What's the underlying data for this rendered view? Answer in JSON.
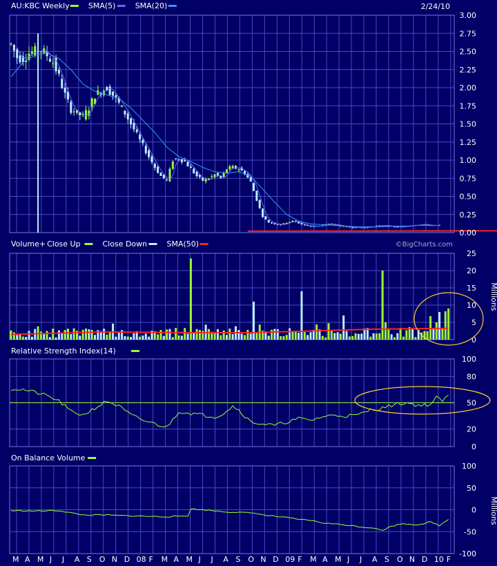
{
  "header": {
    "date": "2/24/10",
    "watermark": "©BigCharts.com"
  },
  "colors": {
    "bg": "#000066",
    "grid": "#4a4ac8",
    "up": "#99ff33",
    "down": "#bbeeff",
    "sma5": "#6666ff",
    "sma20": "#3399ff",
    "sma50": "#ff2222",
    "rsi": "#99ff33",
    "obv": "#99ff33",
    "annotation_circle": "#ffcc33",
    "annotation_line": "#ff2222"
  },
  "x_labels": [
    "M",
    "A",
    "M",
    "J",
    "J",
    "A",
    "S",
    "O",
    "N",
    "D",
    "08",
    "F",
    "M",
    "A",
    "M",
    "J",
    "J",
    "A",
    "S",
    "O",
    "N",
    "D",
    "09",
    "F",
    "M",
    "A",
    "M",
    "J",
    "J",
    "A",
    "S",
    "O",
    "N",
    "D",
    "10",
    "F"
  ],
  "chart_data": [
    {
      "type": "candlestick",
      "legend": [
        {
          "label": "AU:KBC Weekly",
          "color": "#99ff33"
        },
        {
          "label": "SMA(5)",
          "color": "#6666ff"
        },
        {
          "label": "SMA(20)",
          "color": "#3399ff"
        }
      ],
      "y_ticks": [
        "3.00",
        "2.75",
        "2.50",
        "2.25",
        "2.00",
        "1.75",
        "1.50",
        "1.25",
        "1.00",
        "0.75",
        "0.50",
        "0.25",
        "0.00"
      ],
      "ylim": [
        0,
        3
      ],
      "price_path": [
        [
          0,
          2.6
        ],
        [
          2,
          2.42
        ],
        [
          4,
          2.4
        ],
        [
          6,
          2.48
        ],
        [
          8,
          2.5
        ],
        [
          10,
          2.52
        ],
        [
          12,
          2.45
        ],
        [
          14,
          2.35
        ],
        [
          16,
          2.15
        ],
        [
          18,
          1.9
        ],
        [
          20,
          1.7
        ],
        [
          22,
          1.65
        ],
        [
          24,
          1.6
        ],
        [
          26,
          1.72
        ],
        [
          28,
          1.9
        ],
        [
          30,
          1.95
        ],
        [
          32,
          2.0
        ],
        [
          34,
          1.9
        ],
        [
          36,
          1.78
        ],
        [
          38,
          1.65
        ],
        [
          40,
          1.5
        ],
        [
          42,
          1.35
        ],
        [
          44,
          1.2
        ],
        [
          46,
          1.05
        ],
        [
          48,
          0.9
        ],
        [
          50,
          0.78
        ],
        [
          52,
          0.72
        ],
        [
          54,
          1.0
        ],
        [
          56,
          1.02
        ],
        [
          58,
          0.98
        ],
        [
          60,
          0.88
        ],
        [
          62,
          0.78
        ],
        [
          64,
          0.72
        ],
        [
          66,
          0.75
        ],
        [
          68,
          0.8
        ],
        [
          70,
          0.75
        ],
        [
          72,
          0.88
        ],
        [
          74,
          0.9
        ],
        [
          76,
          0.88
        ],
        [
          78,
          0.82
        ],
        [
          80,
          0.7
        ],
        [
          82,
          0.45
        ],
        [
          84,
          0.22
        ],
        [
          86,
          0.14
        ],
        [
          88,
          0.12
        ],
        [
          90,
          0.11
        ],
        [
          92,
          0.14
        ],
        [
          94,
          0.16
        ],
        [
          96,
          0.13
        ],
        [
          98,
          0.1
        ],
        [
          100,
          0.09
        ],
        [
          102,
          0.09
        ],
        [
          104,
          0.1
        ],
        [
          106,
          0.12
        ],
        [
          108,
          0.11
        ],
        [
          110,
          0.09
        ],
        [
          112,
          0.08
        ],
        [
          114,
          0.07
        ],
        [
          116,
          0.07
        ],
        [
          118,
          0.07
        ],
        [
          120,
          0.08
        ],
        [
          122,
          0.09
        ],
        [
          124,
          0.1
        ],
        [
          126,
          0.09
        ],
        [
          128,
          0.08
        ],
        [
          130,
          0.08
        ],
        [
          132,
          0.09
        ],
        [
          134,
          0.1
        ],
        [
          136,
          0.11
        ],
        [
          138,
          0.11
        ],
        [
          140,
          0.1
        ]
      ],
      "spike": {
        "week": 9,
        "high": 2.75,
        "low": 0.0
      },
      "sma20": [
        [
          0,
          2.15
        ],
        [
          4,
          2.35
        ],
        [
          8,
          2.45
        ],
        [
          12,
          2.48
        ],
        [
          16,
          2.4
        ],
        [
          20,
          2.25
        ],
        [
          24,
          2.05
        ],
        [
          28,
          1.95
        ],
        [
          32,
          1.9
        ],
        [
          36,
          1.85
        ],
        [
          40,
          1.72
        ],
        [
          44,
          1.55
        ],
        [
          48,
          1.38
        ],
        [
          52,
          1.18
        ],
        [
          56,
          1.05
        ],
        [
          60,
          0.98
        ],
        [
          64,
          0.9
        ],
        [
          68,
          0.84
        ],
        [
          72,
          0.82
        ],
        [
          76,
          0.84
        ],
        [
          80,
          0.78
        ],
        [
          84,
          0.6
        ],
        [
          88,
          0.42
        ],
        [
          92,
          0.25
        ],
        [
          96,
          0.16
        ],
        [
          100,
          0.12
        ],
        [
          104,
          0.11
        ],
        [
          108,
          0.1
        ],
        [
          112,
          0.09
        ],
        [
          116,
          0.08
        ],
        [
          120,
          0.08
        ],
        [
          124,
          0.08
        ],
        [
          128,
          0.09
        ],
        [
          132,
          0.09
        ],
        [
          136,
          0.1
        ],
        [
          140,
          0.1
        ]
      ],
      "support_line": {
        "value": 0.02,
        "from_week": 79,
        "color": "#ff2222"
      }
    },
    {
      "type": "bar",
      "legend": [
        {
          "label": "Volume+",
          "color": "#ffffff"
        },
        {
          "label": "Close Up",
          "color": "#99ff33"
        },
        {
          "label": "Close Down",
          "color": "#bbeeff"
        },
        {
          "label": "SMA(50)",
          "color": "#ff2222"
        }
      ],
      "y_ticks": [
        "25",
        "20",
        "15",
        "10",
        "5",
        "0"
      ],
      "ylim": [
        0,
        25
      ],
      "ylabel": "Millions",
      "spikes": [
        {
          "week": 60,
          "value": 23.5,
          "up": true
        },
        {
          "week": 81,
          "value": 11,
          "up": false
        },
        {
          "week": 97,
          "value": 14,
          "up": false
        },
        {
          "week": 111,
          "value": 7,
          "up": false
        },
        {
          "week": 124,
          "value": 20,
          "up": true
        },
        {
          "week": 125,
          "value": 5,
          "up": true
        },
        {
          "week": 140,
          "value": 6.8,
          "up": true
        },
        {
          "week": 142,
          "value": 5,
          "up": true
        },
        {
          "week": 143,
          "value": 8,
          "up": false
        },
        {
          "week": 145,
          "value": 8.2,
          "up": true
        },
        {
          "week": 146,
          "value": 9,
          "up": true
        }
      ],
      "sma50": [
        [
          0,
          1.5
        ],
        [
          30,
          2.2
        ],
        [
          60,
          2.0
        ],
        [
          80,
          2.0
        ],
        [
          100,
          2.5
        ],
        [
          120,
          3.0
        ],
        [
          140,
          3.2
        ],
        [
          146,
          3.3
        ]
      ]
    },
    {
      "type": "line",
      "legend": [
        {
          "label": "Relative Strength Index(14)",
          "color": "#99ff33"
        }
      ],
      "y_ticks": [
        "100",
        "80",
        "50",
        "20",
        "0"
      ],
      "ylim": [
        0,
        100
      ],
      "reference": 50,
      "values": [
        [
          0,
          66
        ],
        [
          4,
          65
        ],
        [
          8,
          62
        ],
        [
          12,
          58
        ],
        [
          16,
          52
        ],
        [
          20,
          40
        ],
        [
          24,
          36
        ],
        [
          28,
          44
        ],
        [
          32,
          52
        ],
        [
          36,
          46
        ],
        [
          40,
          36
        ],
        [
          44,
          30
        ],
        [
          48,
          26
        ],
        [
          52,
          22
        ],
        [
          56,
          40
        ],
        [
          60,
          38
        ],
        [
          64,
          36
        ],
        [
          68,
          34
        ],
        [
          70,
          36
        ],
        [
          74,
          46
        ],
        [
          76,
          42
        ],
        [
          80,
          28
        ],
        [
          84,
          26
        ],
        [
          88,
          24
        ],
        [
          92,
          28
        ],
        [
          96,
          32
        ],
        [
          100,
          30
        ],
        [
          104,
          34
        ],
        [
          108,
          36
        ],
        [
          112,
          35
        ],
        [
          116,
          36
        ],
        [
          120,
          42
        ],
        [
          124,
          44
        ],
        [
          128,
          48
        ],
        [
          132,
          50
        ],
        [
          136,
          47
        ],
        [
          140,
          48
        ],
        [
          142,
          56
        ],
        [
          144,
          52
        ],
        [
          146,
          58
        ]
      ]
    },
    {
      "type": "line",
      "legend": [
        {
          "label": "On Balance Volume",
          "color": "#99ff33"
        }
      ],
      "y_ticks": [
        "100",
        "50",
        "0",
        "-50",
        "-100"
      ],
      "ylim": [
        -100,
        100
      ],
      "ylabel": "Millions",
      "values": [
        [
          0,
          -2
        ],
        [
          8,
          -3
        ],
        [
          16,
          -2
        ],
        [
          24,
          -12
        ],
        [
          32,
          -12
        ],
        [
          40,
          -14
        ],
        [
          52,
          -16
        ],
        [
          59,
          -14
        ],
        [
          60,
          2
        ],
        [
          64,
          0
        ],
        [
          72,
          -5
        ],
        [
          76,
          -6
        ],
        [
          82,
          -8
        ],
        [
          84,
          -12
        ],
        [
          92,
          -18
        ],
        [
          96,
          -22
        ],
        [
          100,
          -24
        ],
        [
          104,
          -30
        ],
        [
          112,
          -35
        ],
        [
          118,
          -40
        ],
        [
          122,
          -42
        ],
        [
          124,
          -48
        ],
        [
          126,
          -40
        ],
        [
          130,
          -32
        ],
        [
          136,
          -34
        ],
        [
          140,
          -28
        ],
        [
          143,
          -36
        ],
        [
          146,
          -22
        ]
      ]
    }
  ]
}
